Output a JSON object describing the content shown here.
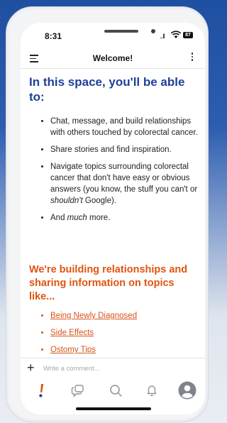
{
  "status": {
    "time": "8:31",
    "battery": "87",
    "signal": "...ll"
  },
  "header": {
    "title": "Welcome!"
  },
  "intro": {
    "heading": "In this space, you'll be able to:",
    "bullets": [
      {
        "text": "Chat, message, and build relationships with others touched by colorectal cancer."
      },
      {
        "text": "Share stories and find inspiration."
      },
      {
        "before": "Navigate topics surrounding colorectal cancer that don't have easy or obvious answers (you know, the stuff you can't or ",
        "em": "shouldn't",
        "after": " Google)."
      },
      {
        "before": "And ",
        "em": "much",
        "after": " more."
      }
    ]
  },
  "topics": {
    "heading": "We're building relationships and sharing information on topics like...",
    "links": [
      "Being Newly Diagnosed",
      "Side Effects",
      "Ostomy Tips"
    ]
  },
  "composer": {
    "placeholder": "Write a comment..."
  },
  "tabbar": {
    "items": [
      {
        "icon": "home-logo-icon"
      },
      {
        "icon": "chat-bubbles-icon"
      },
      {
        "icon": "search-icon"
      },
      {
        "icon": "bell-icon"
      },
      {
        "icon": "profile-avatar-icon"
      }
    ]
  },
  "colors": {
    "heading_blue": "#1d3f9a",
    "accent_orange": "#e05412",
    "link_orange": "#d8531a"
  }
}
